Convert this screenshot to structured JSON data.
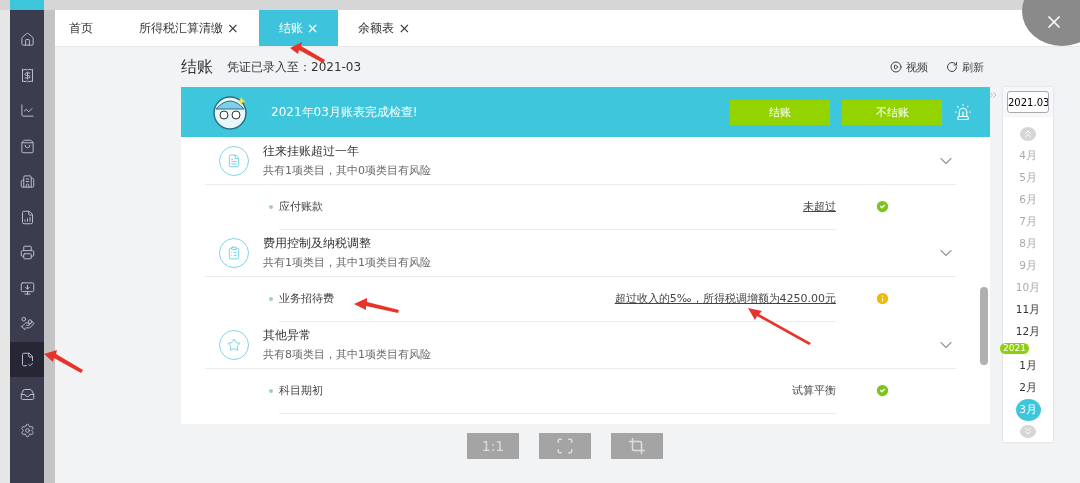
{
  "sidebar": {
    "items": [
      {
        "selected": false
      },
      {
        "selected": false
      },
      {
        "selected": false
      },
      {
        "selected": false
      },
      {
        "selected": false
      },
      {
        "selected": false
      },
      {
        "selected": false
      },
      {
        "selected": false
      },
      {
        "selected": false
      },
      {
        "selected": true
      },
      {
        "selected": false
      },
      {
        "selected": false
      }
    ]
  },
  "tabs": [
    {
      "label": "首页",
      "closable": false,
      "selected": false
    },
    {
      "label": "所得税汇算清缴",
      "closable": true,
      "selected": false
    },
    {
      "label": "结账",
      "closable": true,
      "selected": true
    },
    {
      "label": "余额表",
      "closable": true,
      "selected": false
    }
  ],
  "close_mark": "×",
  "page": {
    "title": "结账",
    "subtitle": "凭证已录入至：2021-03",
    "actions": [
      "视频",
      "刷新"
    ]
  },
  "banner": {
    "message": "2021年03月账表完成检查!",
    "buttons": [
      "结账",
      "不结账"
    ]
  },
  "groups": [
    {
      "title": "往来挂账超过一年",
      "summary": "共有1项类目，其中0项类目有风险",
      "items": [
        {
          "name": "应付账款",
          "result": "未超过",
          "link": true,
          "kind": "ok"
        }
      ]
    },
    {
      "title": "费用控制及纳税调整",
      "summary": "共有1项类目，其中1项类目有风险",
      "items": [
        {
          "name": "业务招待费",
          "result": "超过收入的5‰，所得税调增额为4250.00元",
          "link": true,
          "kind": "warn"
        }
      ]
    },
    {
      "title": "其他异常",
      "summary": "共有8项类目，其中1项类目有风险",
      "items": [
        {
          "name": "科目期初",
          "result": "试算平衡",
          "link": false,
          "kind": "ok"
        }
      ]
    }
  ],
  "month_picker": {
    "value": "2021.03",
    "year_badge": "2021",
    "months": [
      {
        "label": "4月",
        "disabled": true,
        "selected": false,
        "year_start": false
      },
      {
        "label": "5月",
        "disabled": true,
        "selected": false,
        "year_start": false
      },
      {
        "label": "6月",
        "disabled": true,
        "selected": false,
        "year_start": false
      },
      {
        "label": "7月",
        "disabled": true,
        "selected": false,
        "year_start": false
      },
      {
        "label": "8月",
        "disabled": true,
        "selected": false,
        "year_start": false
      },
      {
        "label": "9月",
        "disabled": true,
        "selected": false,
        "year_start": false
      },
      {
        "label": "10月",
        "disabled": true,
        "selected": false,
        "year_start": false
      },
      {
        "label": "11月",
        "disabled": false,
        "selected": false,
        "year_start": false
      },
      {
        "label": "12月",
        "disabled": false,
        "selected": false,
        "year_start": false
      },
      {
        "label": "1月",
        "disabled": false,
        "selected": false,
        "year_start": true
      },
      {
        "label": "2月",
        "disabled": false,
        "selected": false,
        "year_start": false
      },
      {
        "label": "3月",
        "disabled": false,
        "selected": true,
        "year_start": false
      }
    ]
  },
  "toolbar": {
    "zoom_label": "1:1"
  }
}
